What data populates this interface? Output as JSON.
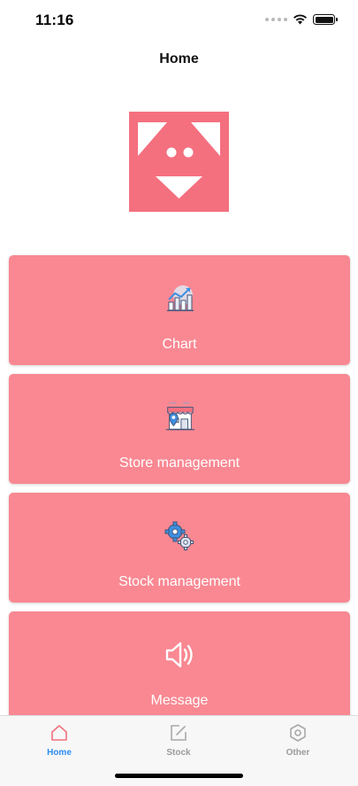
{
  "status_bar": {
    "time": "11:16"
  },
  "header": {
    "title": "Home"
  },
  "logo": {
    "icon": "mascot-face-logo",
    "color": "#f4707f"
  },
  "menu": {
    "items": [
      {
        "label": "Chart",
        "icon": "chart-icon"
      },
      {
        "label": "Store management",
        "icon": "store-icon"
      },
      {
        "label": "Stock management",
        "icon": "gears-icon"
      },
      {
        "label": "Message",
        "icon": "speaker-icon"
      }
    ],
    "card_color": "#f98892"
  },
  "tabs": [
    {
      "label": "Home",
      "icon": "home-icon",
      "active": true
    },
    {
      "label": "Stock",
      "icon": "edit-icon",
      "active": false
    },
    {
      "label": "Other",
      "icon": "settings-icon",
      "active": false
    }
  ],
  "colors": {
    "accent": "#2d8cf0",
    "inactive": "#9a9a9a"
  }
}
